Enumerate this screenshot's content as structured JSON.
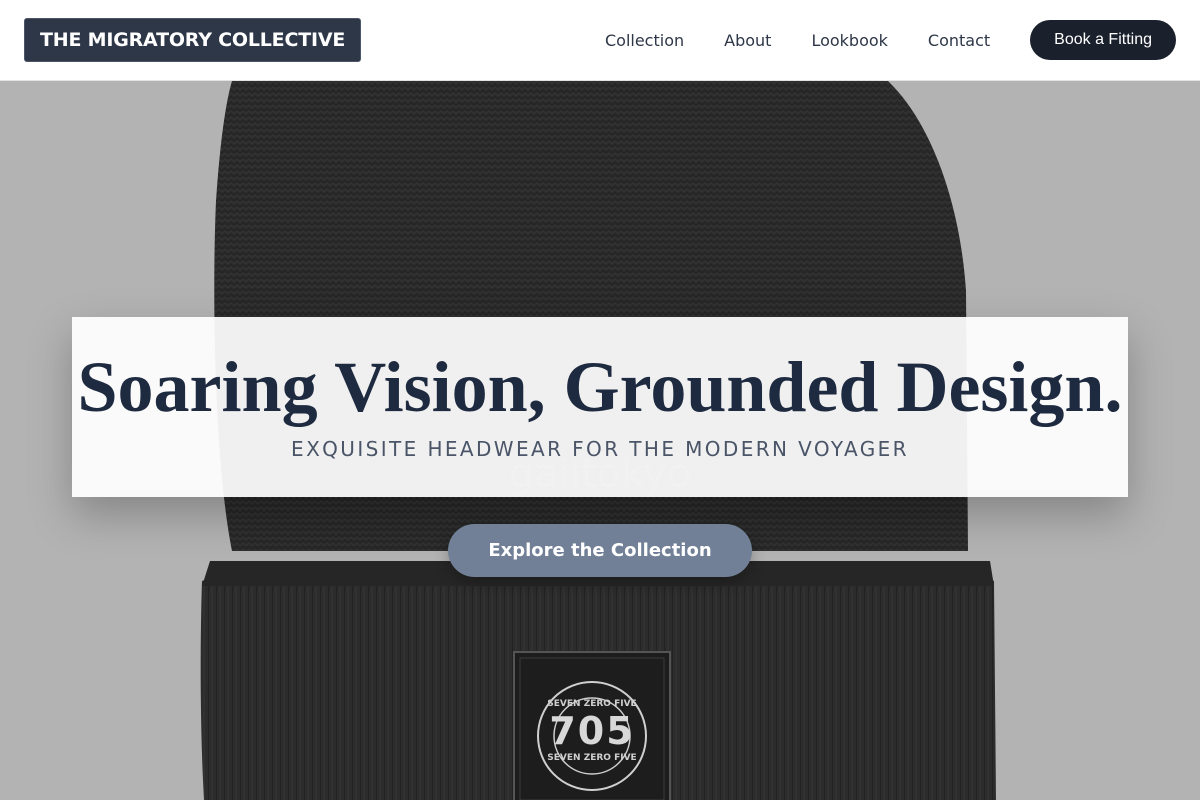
{
  "brand": {
    "name": "THE MIGRATORY COLLECTIVE"
  },
  "nav": {
    "items": [
      {
        "label": "Collection"
      },
      {
        "label": "About"
      },
      {
        "label": "Lookbook"
      },
      {
        "label": "Contact"
      }
    ],
    "cta_label": "Book a Fitting"
  },
  "hero": {
    "title": "Soaring Vision, Grounded Design.",
    "subtitle": "EXQUISITE HEADWEAR FOR THE MODERN VOYAGER",
    "button_label": "Explore the Collection",
    "watermark": "gaiitokyo"
  },
  "product_patch": {
    "number": "705",
    "ring_text_top": "SEVEN ZERO FIVE",
    "ring_text_bottom": "SEVEN ZERO FIVE"
  },
  "colors": {
    "brand_bg": "#2d3748",
    "cta_dark": "#1a202c",
    "title_text": "#1e2a40",
    "button_accent": "#718096",
    "hero_bg": "#b3b3b3",
    "beanie": "#2b2b2b"
  }
}
